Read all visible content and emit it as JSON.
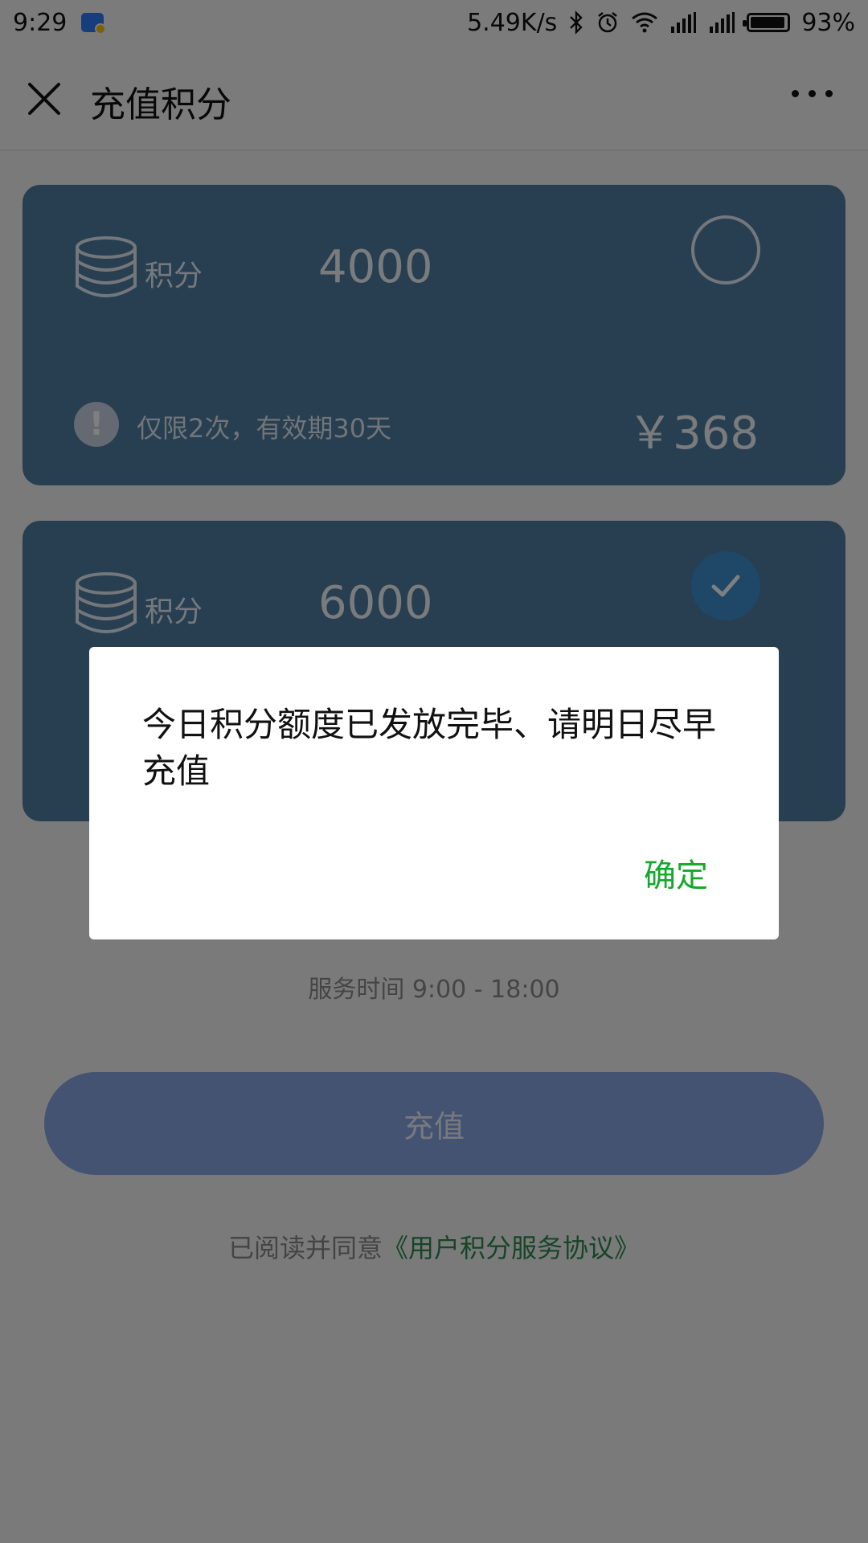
{
  "status_bar": {
    "time": "9:29",
    "network_speed": "5.49K/s",
    "battery_percent": "93%",
    "battery_level": 0.93,
    "icons": [
      "app-notification-icon",
      "bluetooth-icon",
      "alarm-icon",
      "wifi-icon",
      "signal-icon",
      "signal-icon",
      "battery-icon"
    ]
  },
  "nav": {
    "title": "充值积分",
    "close_icon": "close-icon",
    "more_icon": "more-icon"
  },
  "cards": [
    {
      "label": "积分",
      "points": "4000",
      "note": "仅限2次，有效期30天",
      "price": "￥368",
      "selected": false
    },
    {
      "label": "积分",
      "points": "6000",
      "selected": true
    }
  ],
  "service": {
    "time": "服务时间 9:00 - 18:00"
  },
  "recharge_button": "充值",
  "agreement": {
    "prefix": "已阅读并同意",
    "link": "《用户积分服务协议》"
  },
  "dialog": {
    "message": "今日积分额度已发放完毕、请明日尽早充值",
    "confirm": "确定"
  },
  "colors": {
    "card": "#4f7ea2",
    "primary_button": "#86a6e3",
    "confirm_green": "#14a82a",
    "link_green": "#2d8a4e",
    "check_blue": "#3d8fd0"
  }
}
